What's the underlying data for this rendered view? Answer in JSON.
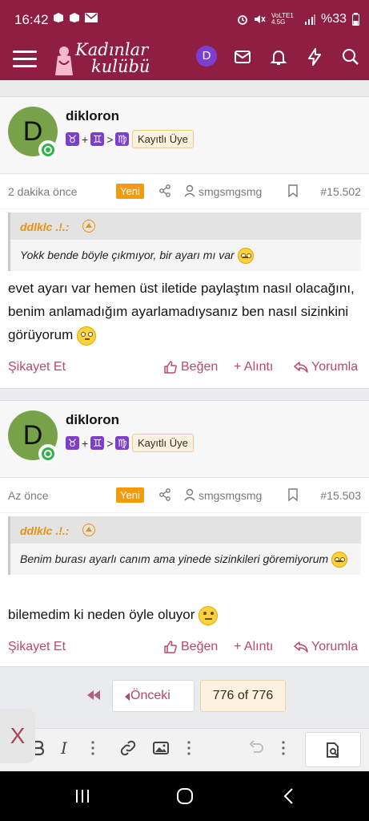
{
  "status_bar": {
    "time": "16:42",
    "network": "VoLTE1 4.5G",
    "battery": "%33"
  },
  "header": {
    "logo_line1": "Kadınlar",
    "logo_line2": "kulübü",
    "avatar_letter": "D"
  },
  "posts": [
    {
      "avatar_letter": "D",
      "username": "dikloron",
      "zodiac": {
        "sign1": "♉",
        "sign2": "♊",
        "sign3": "♍",
        "plus": "+",
        "arrow": ">"
      },
      "rank": "Kayıtlı Üye",
      "time_ago": "2 dakika önce",
      "new_badge": "Yeni",
      "mention": "smgsmgsmg",
      "post_number": "#15.502",
      "quote_author": "ddlklc .!.:",
      "quote_text": "Yokk bende böyle çıkmıyor, bir ayarı mı var",
      "body": "evet ayarı var hemen üst iletide paylaştım nasıl olacağını, benim anlamadığım ayarlamadıysanız ben nasıl sizinkini görüyorum",
      "report": "Şikayet Et",
      "like": "Beğen",
      "quote_action": "+ Alıntı",
      "reply": "Yorumla"
    },
    {
      "avatar_letter": "D",
      "username": "dikloron",
      "zodiac": {
        "sign1": "♉",
        "sign2": "♊",
        "sign3": "♍",
        "plus": "+",
        "arrow": ">"
      },
      "rank": "Kayıtlı Üye",
      "time_ago": "Az önce",
      "new_badge": "Yeni",
      "mention": "smgsmgsmg",
      "post_number": "#15.503",
      "quote_author": "ddlklc .!.:",
      "quote_text": "Benim burası ayarlı canım ama yinede sizinkileri göremiyorum",
      "body": "bilemedim ki neden öyle oluyor",
      "report": "Şikayet Et",
      "like": "Beğen",
      "quote_action": "+ Alıntı",
      "reply": "Yorumla"
    }
  ],
  "pager": {
    "prev_label": "Önceki",
    "page_indicator": "776 of 776"
  },
  "editor": {
    "italic_label": "I",
    "close_label": "X"
  },
  "colors": {
    "brand": "#8f1f42",
    "action": "#b84a66",
    "badge": "#f59a0c",
    "quote_author": "#e8920e"
  }
}
